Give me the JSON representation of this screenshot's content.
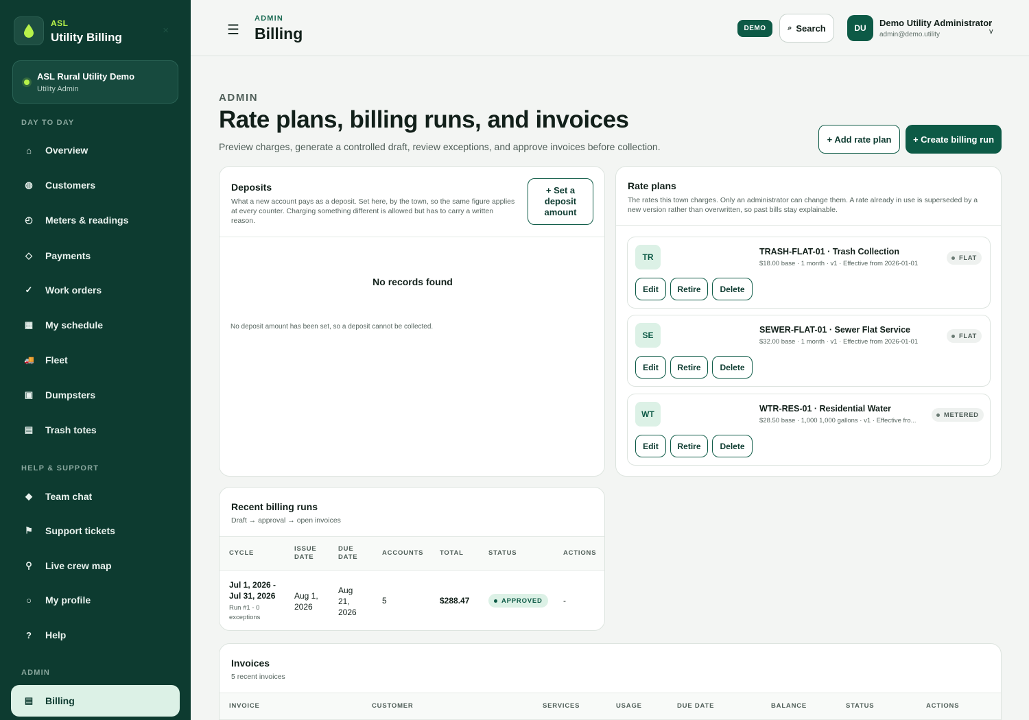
{
  "sidebar": {
    "brand_small": "ASL",
    "brand_title": "Utility Billing",
    "close": "×",
    "org": {
      "name": "ASL Rural Utility Demo",
      "role": "Utility Admin"
    },
    "sections": {
      "day": "DAY TO DAY",
      "help": "HELP & SUPPORT",
      "admin": "ADMIN"
    },
    "items": [
      {
        "label": "Overview",
        "icon": "⌂"
      },
      {
        "label": "Customers",
        "icon": "◍"
      },
      {
        "label": "Meters & readings",
        "icon": "◴"
      },
      {
        "label": "Payments",
        "icon": "◇"
      },
      {
        "label": "Work orders",
        "icon": "✓"
      },
      {
        "label": "My schedule",
        "icon": "▦"
      },
      {
        "label": "Fleet",
        "icon": "🚚"
      },
      {
        "label": "Dumpsters",
        "icon": "▣"
      },
      {
        "label": "Trash totes",
        "icon": "▤"
      },
      {
        "label": "Team chat",
        "icon": "◆"
      },
      {
        "label": "Support tickets",
        "icon": "⚑"
      },
      {
        "label": "Live crew map",
        "icon": "⚲"
      },
      {
        "label": "My profile",
        "icon": "○"
      },
      {
        "label": "Help",
        "icon": "?"
      },
      {
        "label": "Billing",
        "icon": "▤"
      }
    ]
  },
  "topbar": {
    "menu_icon": "☰",
    "eyebrow": "ADMIN",
    "title": "Billing",
    "demo": "DEMO",
    "search_icon": "⌕",
    "search": "Search",
    "avatar": "DU",
    "user_name": "Demo Utility Administrator",
    "user_email": "admin@demo.utility",
    "chevron": "v"
  },
  "page": {
    "eyebrow": "ADMIN",
    "title": "Rate plans, billing runs, and invoices",
    "subtitle": "Preview charges, generate a controlled draft, review exceptions, and approve invoices before collection.",
    "add_rate_plan": "+ Add rate plan",
    "create_billing_run": "+ Create billing run"
  },
  "deposits": {
    "title": "Deposits",
    "desc": "What a new account pays as a deposit. Set here, by the town, so the same figure applies at every counter. Charging something different is allowed but has to carry a written reason.",
    "set_button": "+ Set a deposit amount",
    "empty": "No records found",
    "note": "No deposit amount has been set, so a deposit cannot be collected."
  },
  "rate_plans": {
    "title": "Rate plans",
    "desc": "The rates this town charges. Only an administrator can change them. A rate already in use is superseded by a new version rather than overwritten, so past bills stay explainable.",
    "edit": "Edit",
    "retire": "Retire",
    "delete": "Delete",
    "items": [
      {
        "badge": "TR",
        "name": "TRASH-FLAT-01 · Trash Collection",
        "meta": "$18.00 base · 1 month · v1 · Effective from 2026-01-01",
        "type": "FLAT"
      },
      {
        "badge": "SE",
        "name": "SEWER-FLAT-01 · Sewer Flat Service",
        "meta": "$32.00 base · 1 month · v1 · Effective from 2026-01-01",
        "type": "FLAT"
      },
      {
        "badge": "WT",
        "name": "WTR-RES-01 · Residential Water",
        "meta": "$28.50 base · 1,000 1,000 gallons · v1 · Effective fro...",
        "type": "METERED"
      }
    ]
  },
  "billing_runs": {
    "title": "Recent billing runs",
    "subtitle": "Draft → approval → open invoices",
    "columns": {
      "cycle": "CYCLE",
      "issue": "ISSUE DATE",
      "due": "DUE DATE",
      "accounts": "ACCOUNTS",
      "total": "TOTAL",
      "status": "STATUS",
      "actions": "ACTIONS"
    },
    "row": {
      "cycle": "Jul 1, 2026 - Jul 31, 2026",
      "run": "Run #1 - 0 exceptions",
      "issue": "Aug 1, 2026",
      "due": "Aug 21, 2026",
      "accounts": "5",
      "total": "$288.47",
      "status": "APPROVED",
      "actions": "-"
    }
  },
  "invoices": {
    "title": "Invoices",
    "subtitle": "5 recent invoices",
    "columns": {
      "invoice": "INVOICE",
      "customer": "CUSTOMER",
      "services": "SERVICES",
      "usage": "USAGE",
      "due": "DUE DATE",
      "balance": "BALANCE",
      "status": "STATUS",
      "actions": "ACTIONS"
    }
  },
  "colors": {
    "sidebar": "#0d3b30",
    "accent": "#0d5a46",
    "lime": "#b7f24a",
    "active_bg": "#dcf1e6"
  }
}
